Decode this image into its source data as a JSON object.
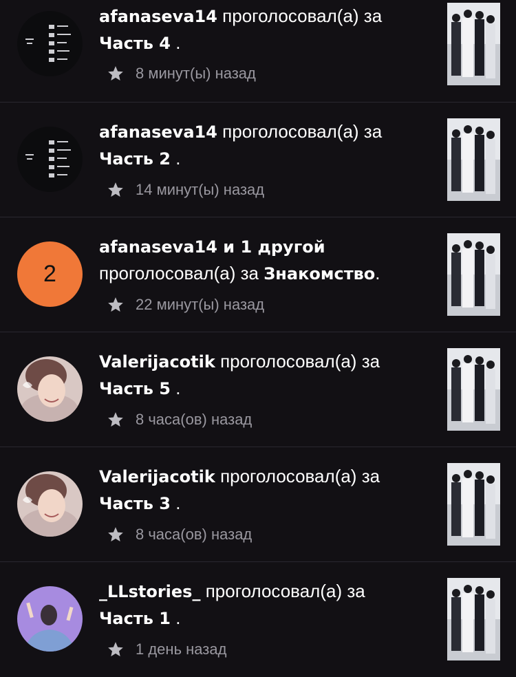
{
  "notifications": [
    {
      "user": "afanaseva14",
      "action": "проголосовал(а) за",
      "part": "Часть 4",
      "end": " .",
      "time": "8 минут(ы) назад",
      "avatar": "playlist-icon"
    },
    {
      "user": "afanaseva14",
      "action": "проголосовал(а) за",
      "part": "Часть 2",
      "end": " .",
      "time": "14 минут(ы) назад",
      "avatar": "playlist-icon"
    },
    {
      "user": "afanaseva14 и 1 другой",
      "action": "проголосовал(а) за",
      "part": "Знакомство",
      "end": ".",
      "time": "22 минут(ы) назад",
      "avatar_count": "2"
    },
    {
      "user": "Valerijacotik",
      "action": "проголосовал(а) за",
      "part": "Часть 5",
      "end": " .",
      "time": "8 часа(ов) назад",
      "avatar": "girl-photo"
    },
    {
      "user": "Valerijacotik",
      "action": "проголосовал(а) за",
      "part": "Часть 3",
      "end": " .",
      "time": "8 часа(ов) назад",
      "avatar": "girl-photo"
    },
    {
      "user": "_LLstories_",
      "action": "проголосовал(а) за",
      "part": "Часть 1",
      "end": " .",
      "time": "1 день назад",
      "avatar": "purple-avatar"
    }
  ],
  "colors": {
    "background": "#121014",
    "count_avatar": "#f07838",
    "meta_text": "#9a98a0",
    "divider": "#2a2830"
  }
}
